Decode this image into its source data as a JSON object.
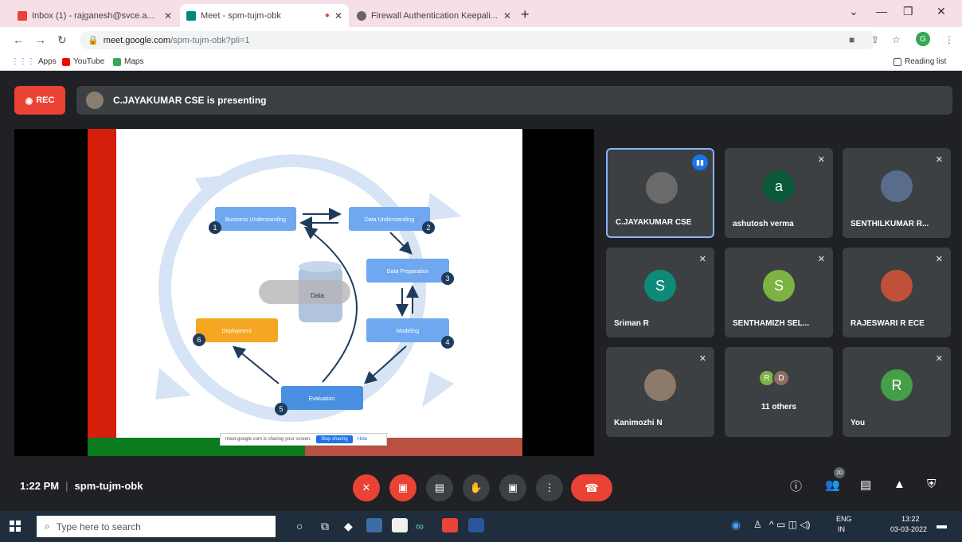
{
  "browser": {
    "tabs": [
      {
        "title": "Inbox (1) - rajganesh@svce.a...",
        "active": false
      },
      {
        "title": "Meet - spm-tujm-obk",
        "active": true
      },
      {
        "title": "Firewall Authentication Keepali...",
        "active": false
      }
    ],
    "url_host": "meet.google.com",
    "url_path": "/spm-tujm-obk?pli=1",
    "bookmarks": [
      "Apps",
      "YouTube",
      "Maps"
    ],
    "reading_list": "Reading list",
    "profile_initial": "G"
  },
  "meet": {
    "rec_label": "REC",
    "presenting_text": "C.JAYAKUMAR CSE is presenting",
    "slide": {
      "center_label": "Data",
      "share_banner": "meet.google.com is sharing your screen.",
      "stop_sharing": "Stop sharing",
      "hide": "Hide",
      "steps": [
        {
          "n": "1",
          "label": "Business Understanding"
        },
        {
          "n": "2",
          "label": "Data Understanding"
        },
        {
          "n": "3",
          "label": "Data Preparation"
        },
        {
          "n": "4",
          "label": "Modeling"
        },
        {
          "n": "5",
          "label": "Evaluation"
        },
        {
          "n": "6",
          "label": "Deployment"
        }
      ]
    },
    "participants": [
      {
        "name": "C.JAYAKUMAR CSE",
        "initial": "",
        "speaking": true
      },
      {
        "name": "ashutosh verma",
        "initial": "a",
        "color": "#0b5a3a"
      },
      {
        "name": "SENTHILKUMAR R...",
        "initial": "",
        "color": "#5a6c8c"
      },
      {
        "name": "Sriman R",
        "initial": "S",
        "color": "#0d8a7a"
      },
      {
        "name": "SENTHAMIZH SEL...",
        "initial": "S",
        "color": "#7cb342"
      },
      {
        "name": "RAJESWARI R ECE",
        "initial": "",
        "color": "#c0503a"
      },
      {
        "name": "Kanimozhi N",
        "initial": "",
        "color": "#8c7a6a"
      },
      {
        "name": "You",
        "initial": "R",
        "color": "#43a047"
      }
    ],
    "others": {
      "label": "11 others",
      "initials": [
        "R",
        "D"
      ]
    },
    "time": "1:22 PM",
    "meeting_code": "spm-tujm-obk",
    "participant_count": "20"
  },
  "taskbar": {
    "search_placeholder": "Type here to search",
    "lang": "ENG",
    "region": "IN",
    "time": "13:22",
    "date": "03-03-2022"
  }
}
